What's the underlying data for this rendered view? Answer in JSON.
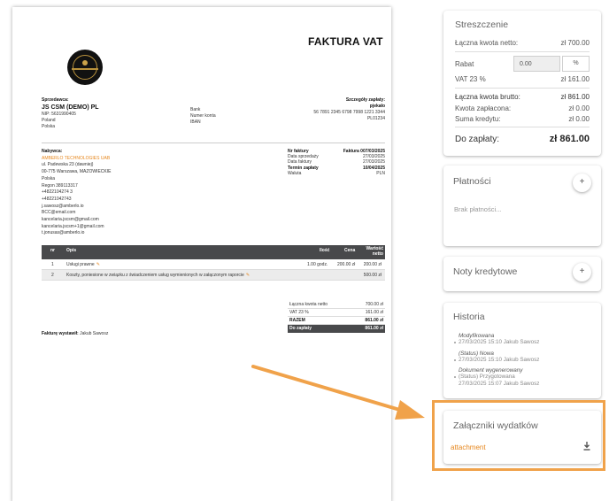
{
  "invoice": {
    "title": "FAKTURA VAT",
    "seller": {
      "label": "Sprzedawca:",
      "name": "JS CSM (DEMO) PL",
      "nip": "NIP: 5631990405",
      "country": "Poland",
      "country_pl": "Polska"
    },
    "bank": {
      "bank": "Bank",
      "account": "Numer konta",
      "iban": "IBAN"
    },
    "payment": {
      "label": "Szczegóły zapłaty:",
      "bank_name": "pjekało",
      "account": "56 7891 2345 6798 7998 1221 3344",
      "iban": "PL01234"
    },
    "buyer": {
      "label": "Nabywca:",
      "company": "AMBERLO TECHNOLOGIES UAB",
      "lines": [
        "ul. Padewska 23 (dawniej)",
        "00-775 Warszawa, MAZOWIECKIE",
        "Polska",
        "Regon 389113317",
        "+4822104274 3",
        "+48221042743",
        "j.sawosz@amberlo.io",
        "BCC@email.com",
        "kancelaria.jscsm@gmail.com",
        "kancelaria.jscsm+1@gmail.com",
        "t.jonusas@amberlo.io"
      ]
    },
    "info": [
      {
        "label": "Nr faktury",
        "value": "Faktura 007/03/2025",
        "bold": true
      },
      {
        "label": "Data sprzedaży",
        "value": "27/03/2025",
        "bold": false
      },
      {
        "label": "Data faktury",
        "value": "27/03/2025",
        "bold": false
      },
      {
        "label": "Termin zapłaty",
        "value": "10/04/2025",
        "bold": true
      },
      {
        "label": "Waluta",
        "value": "PLN",
        "bold": false
      }
    ],
    "table": {
      "headers": {
        "nr": "nr",
        "desc": "Opis",
        "qty": "Ilość",
        "price": "Cena",
        "net": "Wartość netto"
      },
      "rows": [
        {
          "nr": "1",
          "desc": "Usługi prawne",
          "qty": "1.00 godz.",
          "price": "200.00 zł",
          "net": "200.00 zł"
        },
        {
          "nr": "2",
          "desc": "Koszty, poniesione w związku z świadczeniem usług wymienionych w załączonym raporcie",
          "qty": "",
          "price": "",
          "net": "500.00 zł"
        }
      ]
    },
    "totals": [
      {
        "label": "Łączna kwota netto",
        "value": "700.00 zł",
        "style": "normal"
      },
      {
        "label": "VAT 23 %",
        "value": "161.00 zł",
        "style": "normal"
      },
      {
        "label": "RAZEM",
        "value": "861.00 zł",
        "style": "bold"
      },
      {
        "label": "Do zapłaty",
        "value": "861.00 zł",
        "style": "dark"
      }
    ],
    "issuer_label": "Fakturę wystawił:",
    "issuer_name": "Jakub Sawosz"
  },
  "summary": {
    "title": "Streszczenie",
    "net_label": "Łączna kwota netto:",
    "net_value": "zł 700.00",
    "discount_label": "Rabat",
    "discount_value": "0.00",
    "discount_unit": "%",
    "vat_label": "VAT 23 %",
    "vat_value": "zł 161.00",
    "gross_label": "Łączna kwota brutto:",
    "gross_value": "zł 861.00",
    "paid_label": "Kwota zapłacona:",
    "paid_value": "zł 0.00",
    "credit_label": "Suma kredytu:",
    "credit_value": "zł 0.00",
    "due_label": "Do zapłaty:",
    "due_value": "zł 861.00"
  },
  "payments": {
    "title": "Płatności",
    "add": "+",
    "empty": "Brak płatności..."
  },
  "credit_notes": {
    "title": "Noty kredytowe",
    "add": "+"
  },
  "history": {
    "title": "Historia",
    "items": [
      {
        "title": "Modyfikowana",
        "status": "",
        "meta": "27/03/2025 15:10 Jakub Sawosz"
      },
      {
        "title": "(Status) Nowa",
        "status": "",
        "meta": "27/03/2025 15:10 Jakub Sawosz"
      },
      {
        "title": "Dokument wygenerowany",
        "status": "(Status) Przygotowana",
        "meta": "27/03/2025 15:07 Jakub Sawosz"
      }
    ]
  },
  "attachments": {
    "title": "Załączniki wydatków",
    "link": "attachment"
  },
  "colors": {
    "accent": "#e6861c",
    "highlight": "#f0a24a",
    "table_header": "#48494b"
  }
}
